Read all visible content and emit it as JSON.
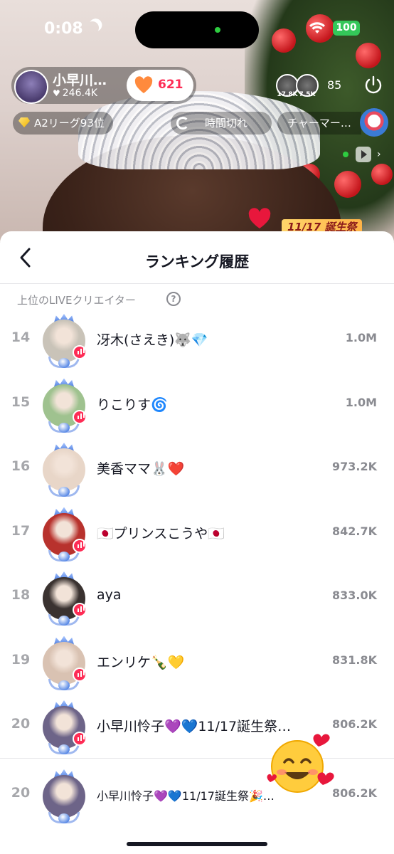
{
  "status_bar": {
    "time": "0:08",
    "battery": "100",
    "icons": [
      "moon-icon",
      "wifi-icon",
      "battery-icon"
    ]
  },
  "live_header": {
    "host_name": "小早川…",
    "host_likes": "246.4K",
    "follow_count": "621",
    "viewer_badges": [
      "17.8K",
      "7.5K"
    ],
    "viewer_count": "85",
    "league": "A2リーグ93位",
    "timeout": "時間切れ",
    "charm": "チャーマー…",
    "event_text": "11/17 誕生祭"
  },
  "sheet": {
    "title": "ランキング履歴",
    "section_label": "上位のLIVEクリエイター",
    "info_glyph": "?",
    "rows": [
      {
        "rank": "14",
        "name": "冴木(さえき)🐺💎",
        "score": "1.0M",
        "avatar_color": "#c9c3b8"
      },
      {
        "rank": "15",
        "name": "りこりす🌀",
        "score": "1.0M",
        "avatar_color": "#9fc28f"
      },
      {
        "rank": "16",
        "name": "美香ママ🐰❤️",
        "score": "973.2K",
        "avatar_color": "#e8d6c8"
      },
      {
        "rank": "17",
        "name": "🇯🇵プリンスこうや🇯🇵",
        "score": "842.7K",
        "avatar_color": "#b8322d"
      },
      {
        "rank": "18",
        "name": "aya",
        "score": "833.0K",
        "avatar_color": "#3a3230"
      },
      {
        "rank": "19",
        "name": "エンリケ🍾💛",
        "score": "831.8K",
        "avatar_color": "#d9c2b2"
      },
      {
        "rank": "20",
        "name": "小早川怜子💜💙11/17誕生祭…",
        "score": "806.2K",
        "avatar_color": "#6d6488"
      }
    ],
    "self_row": {
      "rank": "20",
      "name": "小早川怜子💜💙11/17誕生祭🎉…",
      "score": "806.2K",
      "avatar_color": "#6d6488"
    },
    "sticker": "🥰"
  },
  "colors": {
    "accent": "#fe2c55",
    "muted": "#8a8b91",
    "text": "#161823"
  }
}
